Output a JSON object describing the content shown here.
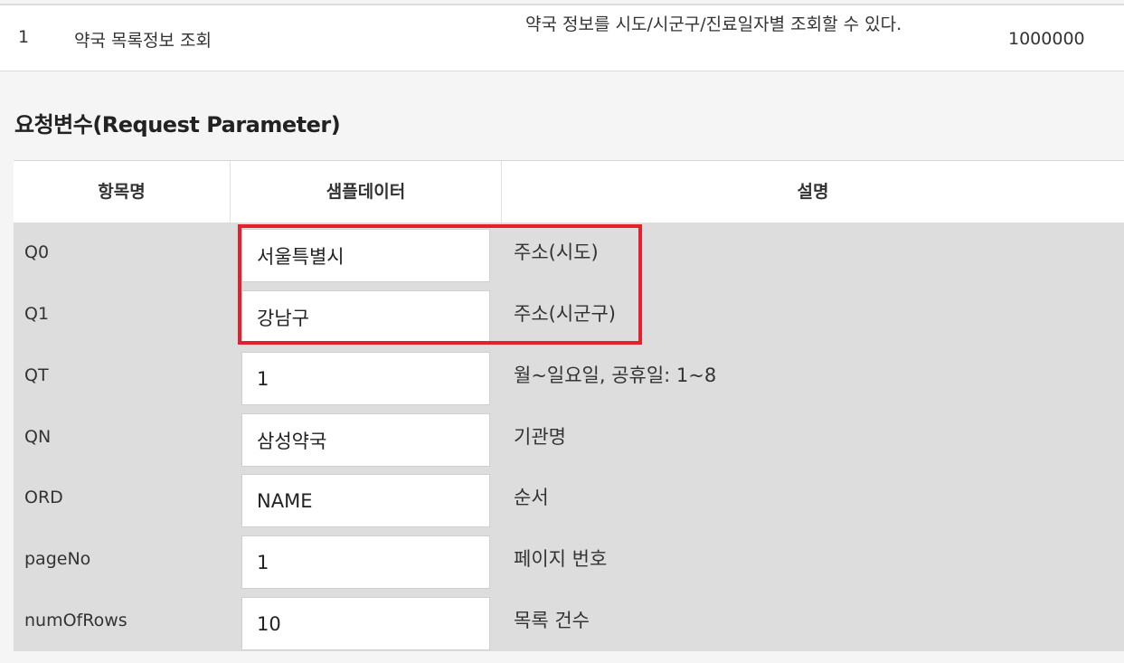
{
  "operation": {
    "no": "1",
    "name": "약국 목록정보 조회",
    "description": "약국 정보를 시도/시군구/진료일자별 조회할 수 있다.",
    "traffic": "1000000"
  },
  "request_section": {
    "title": "요청변수(Request Parameter)"
  },
  "param_table": {
    "headers": [
      "항목명",
      "샘플데이터",
      "설명"
    ],
    "rows": [
      {
        "name": "Q0",
        "sample": "서울특별시",
        "description": "주소(시도)"
      },
      {
        "name": "Q1",
        "sample": "강남구",
        "description": "주소(시군구)"
      },
      {
        "name": "QT",
        "sample": "1",
        "description": "월~일요일, 공휴일: 1~8"
      },
      {
        "name": "QN",
        "sample": "삼성약국",
        "description": "기관명"
      },
      {
        "name": "ORD",
        "sample": "NAME",
        "description": "순서"
      },
      {
        "name": "pageNo",
        "sample": "1",
        "description": "페이지 번호"
      },
      {
        "name": "numOfRows",
        "sample": "10",
        "description": "목록 건수"
      }
    ]
  },
  "highlight": {
    "color": "#e3202b"
  },
  "colors": {
    "row_background": "#dddddd",
    "header_background": "#ffffff",
    "page_background": "#f5f5f5"
  }
}
